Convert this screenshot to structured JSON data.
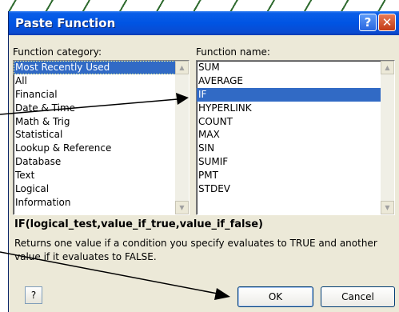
{
  "dialog": {
    "title": "Paste Function",
    "help_icon": "help-question-icon",
    "close_icon": "close-x-icon"
  },
  "category": {
    "label": "Function category:",
    "items": [
      "Most Recently Used",
      "All",
      "Financial",
      "Date & Time",
      "Math & Trig",
      "Statistical",
      "Lookup & Reference",
      "Database",
      "Text",
      "Logical",
      "Information"
    ],
    "selected": "Most Recently Used"
  },
  "function_name": {
    "label": "Function name:",
    "items": [
      "SUM",
      "AVERAGE",
      "IF",
      "HYPERLINK",
      "COUNT",
      "MAX",
      "SIN",
      "SUMIF",
      "PMT",
      "STDEV"
    ],
    "selected": "IF"
  },
  "syntax": "IF(logical_test,value_if_true,value_if_false)",
  "description": "Returns one value if a condition you specify evaluates to TRUE and another value if it evaluates to FALSE.",
  "buttons": {
    "help_icon": "help-question-icon",
    "help_glyph": "?",
    "ok": "OK",
    "cancel": "Cancel"
  },
  "colors": {
    "titlebar": "#0054e3",
    "selection": "#316ac5",
    "dialog_bg": "#ece9d8"
  }
}
